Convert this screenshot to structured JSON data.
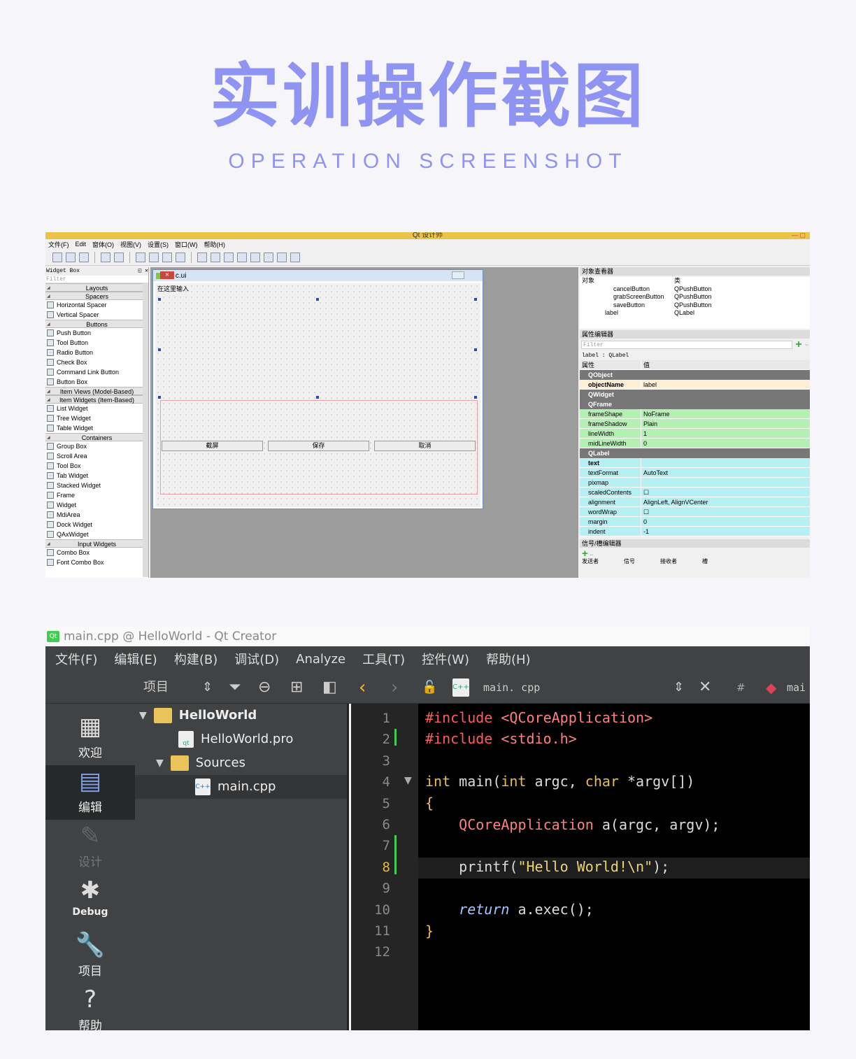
{
  "header": {
    "title": "实训操作截图",
    "subtitle": "OPERATION SCREENSHOT"
  },
  "designer": {
    "window_title": "Qt 设计师",
    "menu": [
      "文件(F)",
      "Edit",
      "窗体(O)",
      "视图(V)",
      "设置(S)",
      "窗口(W)",
      "帮助(H)"
    ],
    "widget_box": {
      "title": "Widget Box",
      "filter_placeholder": "Filter",
      "rows": [
        {
          "t": "cat",
          "label": "Layouts"
        },
        {
          "t": "cat",
          "label": "Spacers"
        },
        {
          "t": "item",
          "label": "Horizontal Spacer"
        },
        {
          "t": "item",
          "label": "Vertical Spacer"
        },
        {
          "t": "cat",
          "label": "Buttons"
        },
        {
          "t": "item",
          "label": "Push Button"
        },
        {
          "t": "item",
          "label": "Tool Button"
        },
        {
          "t": "item",
          "label": "Radio Button"
        },
        {
          "t": "item",
          "label": "Check Box"
        },
        {
          "t": "item",
          "label": "Command Link Button"
        },
        {
          "t": "item",
          "label": "Button Box"
        },
        {
          "t": "cat",
          "label": "Item Views (Model-Based)"
        },
        {
          "t": "cat",
          "label": "Item Widgets (Item-Based)"
        },
        {
          "t": "item",
          "label": "List Widget"
        },
        {
          "t": "item",
          "label": "Tree Widget"
        },
        {
          "t": "item",
          "label": "Table Widget"
        },
        {
          "t": "cat",
          "label": "Containers"
        },
        {
          "t": "item",
          "label": "Group Box"
        },
        {
          "t": "item",
          "label": "Scroll Area"
        },
        {
          "t": "item",
          "label": "Tool Box"
        },
        {
          "t": "item",
          "label": "Tab Widget"
        },
        {
          "t": "item",
          "label": "Stacked Widget"
        },
        {
          "t": "item",
          "label": "Frame"
        },
        {
          "t": "item",
          "label": "Widget"
        },
        {
          "t": "item",
          "label": "MdiArea"
        },
        {
          "t": "item",
          "label": "Dock Widget"
        },
        {
          "t": "item",
          "label": "QAxWidget"
        },
        {
          "t": "cat",
          "label": "Input Widgets"
        },
        {
          "t": "item",
          "label": "Combo Box"
        },
        {
          "t": "item",
          "label": "Font Combo Box"
        }
      ]
    },
    "form": {
      "title": "c - c.ui",
      "input_label": "在这里输入",
      "buttons": [
        "截屏",
        "保存",
        "取消"
      ]
    },
    "object_inspector": {
      "title": "对象查看器",
      "col_object": "对象",
      "col_class": "类",
      "rows": [
        {
          "name": "cancelButton",
          "cls": "QPushButton"
        },
        {
          "name": "grabScreenButton",
          "cls": "QPushButton"
        },
        {
          "name": "saveButton",
          "cls": "QPushButton"
        },
        {
          "name": "label",
          "cls": "QLabel"
        }
      ]
    },
    "property_editor": {
      "title": "属性编辑器",
      "filter_placeholder": "Filter",
      "subject": "label : QLabel",
      "col_prop": "属性",
      "col_val": "值",
      "rows": [
        {
          "t": "sec",
          "k": "QObject"
        },
        {
          "t": "y",
          "k": "objectName",
          "v": "label"
        },
        {
          "t": "sec",
          "k": "QWidget"
        },
        {
          "t": "sec",
          "k": "QFrame"
        },
        {
          "t": "g",
          "k": "frameShape",
          "v": "NoFrame"
        },
        {
          "t": "g",
          "k": "frameShadow",
          "v": "Plain"
        },
        {
          "t": "g",
          "k": "lineWidth",
          "v": "1"
        },
        {
          "t": "g",
          "k": "midLineWidth",
          "v": "0"
        },
        {
          "t": "sec",
          "k": "QLabel"
        },
        {
          "t": "c",
          "k": "text",
          "v": ""
        },
        {
          "t": "c",
          "k": "textFormat",
          "v": "AutoText"
        },
        {
          "t": "c",
          "k": "pixmap",
          "v": ""
        },
        {
          "t": "c",
          "k": "scaledContents",
          "v": "☐"
        },
        {
          "t": "c",
          "k": "alignment",
          "v": "AlignLeft, AlignVCenter"
        },
        {
          "t": "c",
          "k": "wordWrap",
          "v": "☐"
        },
        {
          "t": "c",
          "k": "margin",
          "v": "0"
        },
        {
          "t": "c",
          "k": "indent",
          "v": "-1"
        }
      ]
    },
    "signal_editor": {
      "title": "信号/槽编辑器",
      "cols": [
        "发送者",
        "信号",
        "接收者",
        "槽"
      ]
    }
  },
  "creator": {
    "window_title": "main.cpp @ HelloWorld - Qt Creator",
    "menu": [
      "文件(F)",
      "编辑(E)",
      "构建(B)",
      "调试(D)",
      "Analyze",
      "工具(T)",
      "控件(W)",
      "帮助(H)"
    ],
    "toolbar": {
      "projects_label": "项目",
      "file_name": "main. cpp",
      "hash": "#",
      "symbol": "mai"
    },
    "modes": [
      "欢迎",
      "编辑",
      "设计",
      "Debug",
      "项目",
      "帮助"
    ],
    "tree": {
      "project": "HelloWorld",
      "pro_file": "HelloWorld.pro",
      "sources": "Sources",
      "main": "main.cpp"
    },
    "line_numbers": [
      "1",
      "2",
      "3",
      "4",
      "5",
      "6",
      "7",
      "8",
      "9",
      "10",
      "11",
      "12"
    ]
  }
}
